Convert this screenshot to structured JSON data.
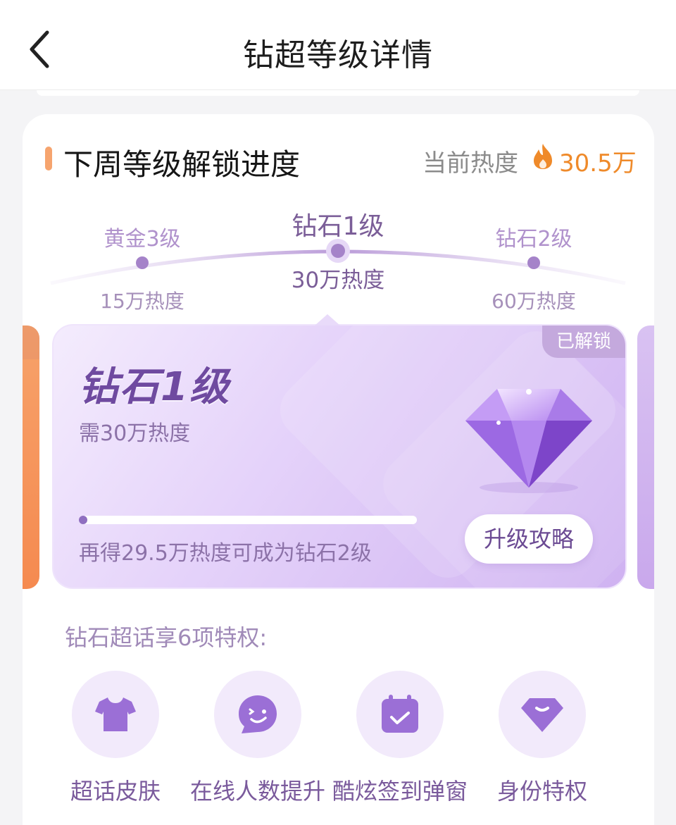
{
  "nav": {
    "title": "钻超等级详情",
    "back_icon": "chevron-left-icon"
  },
  "section": {
    "heading": "下周等级解锁进度",
    "current_heat_label": "当前热度",
    "current_heat_value": "30.5万"
  },
  "track": [
    {
      "name": "黄金3级",
      "requirement": "15万热度"
    },
    {
      "name": "钻石1级",
      "requirement": "30万热度",
      "active": true
    },
    {
      "name": "钻石2级",
      "requirement": "60万热度"
    }
  ],
  "level_card": {
    "badge": "已解锁",
    "name": "钻石1级",
    "requirement": "需30万热度",
    "progress_fraction": 0.01,
    "hint": "再得29.5万热度可成为钻石2级",
    "button": "升级攻略"
  },
  "perks": {
    "title": "钻石超话享6项特权:",
    "items": [
      {
        "label": "超话皮肤",
        "icon": "tshirt-icon"
      },
      {
        "label": "在线人数提升",
        "icon": "smile-chat-icon"
      },
      {
        "label": "酷炫签到弹窗",
        "icon": "calendar-check-icon"
      },
      {
        "label": "身份特权",
        "icon": "diamond-badge-icon"
      }
    ]
  },
  "colors": {
    "accent_orange": "#ef8a2a",
    "purple_dark": "#6f4aa0",
    "purple_mid": "#8f6fc0"
  }
}
